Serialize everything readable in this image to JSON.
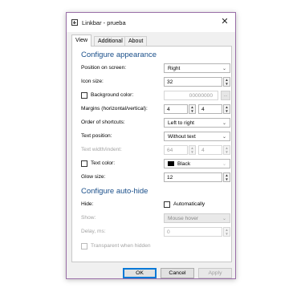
{
  "window": {
    "title": "Linkbar - prueba",
    "close_glyph": "✕"
  },
  "tabs": [
    {
      "label": "View"
    },
    {
      "label": "Additional"
    },
    {
      "label": "About"
    }
  ],
  "appearance": {
    "heading": "Configure appearance",
    "position": {
      "label": "Position on screen:",
      "value": "Right"
    },
    "icon_size": {
      "label": "Icon size:",
      "value": "32"
    },
    "background": {
      "label": "Background color:",
      "value": "00000000",
      "button": "..."
    },
    "margins": {
      "label": "Margins (horizontal/vertical):",
      "h": "4",
      "v": "4"
    },
    "order": {
      "label": "Order of shortcuts:",
      "value": "Left to right"
    },
    "text_position": {
      "label": "Text position:",
      "value": "Without text"
    },
    "text_width": {
      "label": "Text width/indent:",
      "w": "64",
      "i": "4"
    },
    "text_color": {
      "label": "Text color:",
      "value": "Black"
    },
    "glow": {
      "label": "Glow size:",
      "value": "12"
    }
  },
  "autohide": {
    "heading": "Configure auto-hide",
    "hide": {
      "label": "Hide:",
      "checkbox_label": "Automatically"
    },
    "show": {
      "label": "Show:",
      "value": "Mouse hover"
    },
    "delay": {
      "label": "Delay, ms:",
      "value": "0"
    },
    "transparent": {
      "label": "Transparent when hidden"
    }
  },
  "buttons": {
    "ok": "OK",
    "cancel": "Cancel",
    "apply": "Apply"
  },
  "colors": {
    "heading": "#1a4f8a",
    "accent": "#0078d7",
    "window_border": "#9a6fa8"
  }
}
